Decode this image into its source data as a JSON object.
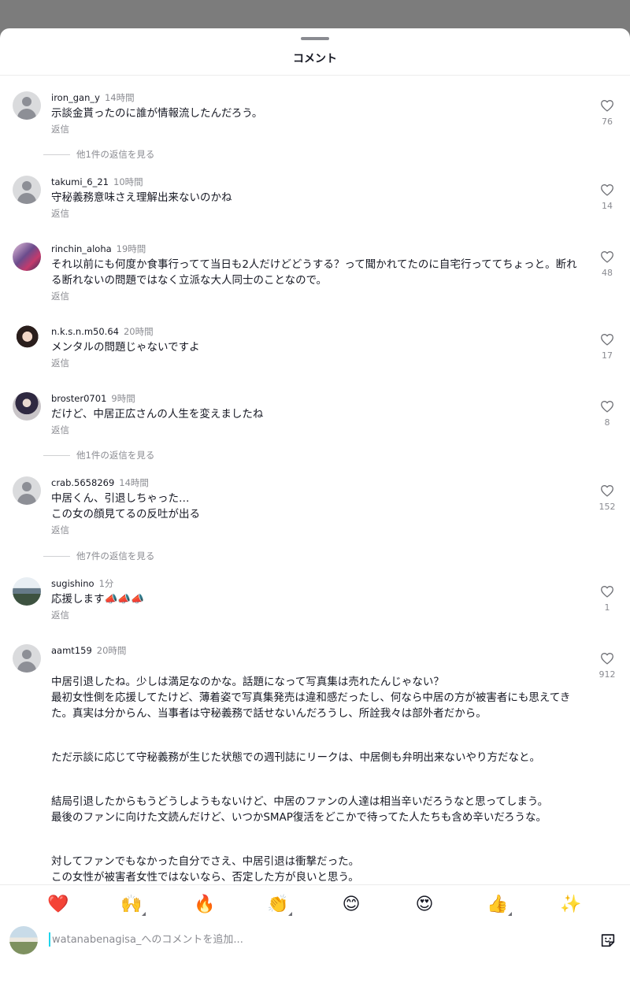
{
  "sheet": {
    "title": "コメント"
  },
  "comments": [
    {
      "user": "iron_gan_y",
      "time": "14時間",
      "text": [
        "示談金貰ったのに誰が情報流したんだろう。"
      ],
      "reply": "返信",
      "likes": "76",
      "more": "他1件の返信を見る"
    },
    {
      "user": "takumi_6_21",
      "time": "10時間",
      "text": [
        "守秘義務意味さえ理解出来ないのかね"
      ],
      "reply": "返信",
      "likes": "14"
    },
    {
      "user": "rinchin_aloha",
      "time": "19時間",
      "text": [
        "それ以前にも何度か食事行ってて当日も2人だけどどうする？って聞かれてたのに自宅行っててちょっと。断れる断れないの問題ではなく立派な大人同士のことなので。"
      ],
      "reply": "返信",
      "likes": "48"
    },
    {
      "user": "n.k.s.n.m50.64",
      "time": "20時間",
      "text": [
        "メンタルの問題じゃないですよ"
      ],
      "reply": "返信",
      "likes": "17"
    },
    {
      "user": "broster0701",
      "time": "9時間",
      "text": [
        "だけど、中居正広さんの人生を変えましたね"
      ],
      "reply": "返信",
      "likes": "8",
      "more": "他1件の返信を見る"
    },
    {
      "user": "crab.5658269",
      "time": "14時間",
      "text": [
        "中居くん、引退しちゃった…\nこの女の顔見てるの反吐が出る"
      ],
      "reply": "返信",
      "likes": "152",
      "more": "他7件の返信を見る"
    },
    {
      "user": "sugishino",
      "time": "1分",
      "text": [
        "応援します📣📣📣"
      ],
      "reply": "返信",
      "likes": "1"
    },
    {
      "user": "aamt159",
      "time": "20時間",
      "text": [
        "中居引退したね。少しは満足なのかな。話題になって写真集は売れたんじゃない？\n最初女性側を応援してたけど、薄着姿で写真集発売は違和感だったし、何なら中居の方が被害者にも思えてきた。真実は分からん、当事者は守秘義務で話せないんだろうし、所詮我々は部外者だから。",
        "ただ示談に応じて守秘義務が生じた状態での週刊誌にリークは、中居側も弁明出来ないやり方だなと。",
        "結局引退したからもうどうしようもないけど、中居のファンの人達は相当辛いだろうなと思ってしまう。\n最後のファンに向けた文読んだけど、いつかSMAP復活をどこかで待ってた人たちも含め辛いだろうな。",
        "対してファンでもなかった自分でさえ、中居引退は衝撃だった。\nこの女性が被害者女性ではないなら、否定した方が良いと思う。\n違うなら守秘義務ない訳だし。\nまあ本当部外者の意見だけどね。"
      ],
      "reply": "返信",
      "likes": "912"
    }
  ],
  "emojis": [
    "❤️",
    "🙌",
    "🔥",
    "👏",
    "😊",
    "😍",
    "👍",
    "✨"
  ],
  "input": {
    "placeholder": "watanabenagisa_へのコメントを追加..."
  },
  "icons": {
    "heart": "heart-outline-icon",
    "sticker": "sticker-icon"
  }
}
